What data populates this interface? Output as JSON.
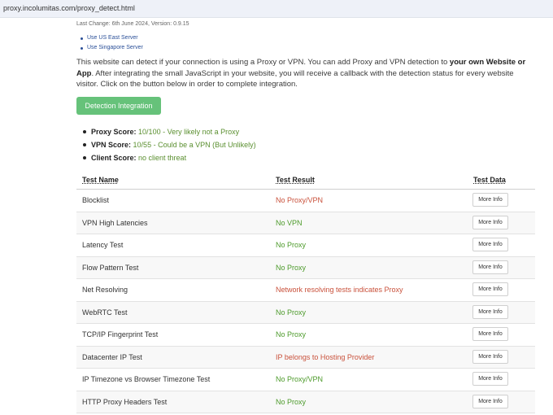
{
  "browser": {
    "url": "proxy.incolumitas.com/proxy_detect.html"
  },
  "meta": {
    "last_change": "Last Change: 6th June 2024, Version: 0.9.15"
  },
  "servers": [
    {
      "label": "Use US East Server"
    },
    {
      "label": "Use Singapore Server"
    }
  ],
  "intro": {
    "part1": "This website can detect if your connection is using a Proxy or VPN. You can add Proxy and VPN detection to ",
    "bold": "your own Website or App",
    "part2": ". After integrating the small JavaScript in your website, you will receive a callback with the detection status for every website visitor. Click on the button below in order to complete integration."
  },
  "integration_button": "Detection Integration",
  "scores": [
    {
      "label": "Proxy Score:",
      "value": "10/100 - Very likely not a Proxy"
    },
    {
      "label": "VPN Score:",
      "value": "10/55 - Could be a VPN (But Unlikely)"
    },
    {
      "label": "Client Score:",
      "value": "no client threat"
    }
  ],
  "table": {
    "headers": {
      "name": "Test Name",
      "result": "Test Result",
      "data": "Test Data"
    },
    "rows": [
      {
        "name": "Blocklist",
        "result": "No Proxy/VPN",
        "status": "bad",
        "button": "More Info"
      },
      {
        "name": "VPN High Latencies",
        "result": "No VPN",
        "status": "good",
        "button": "More Info"
      },
      {
        "name": "Latency Test",
        "result": "No Proxy",
        "status": "good",
        "button": "More Info"
      },
      {
        "name": "Flow Pattern Test",
        "result": "No Proxy",
        "status": "good",
        "button": "More Info"
      },
      {
        "name": "Net Resolving",
        "result": "Network resolving tests indicates Proxy",
        "status": "bad",
        "button": "More Info"
      },
      {
        "name": "WebRTC Test",
        "result": "No Proxy",
        "status": "good",
        "button": "More Info"
      },
      {
        "name": "TCP/IP Fingerprint Test",
        "result": "No Proxy",
        "status": "good",
        "button": "More Info"
      },
      {
        "name": "Datacenter IP Test",
        "result": "IP belongs to Hosting Provider",
        "status": "bad",
        "button": "More Info"
      },
      {
        "name": "IP Timezone vs Browser Timezone Test",
        "result": "No Proxy/VPN",
        "status": "good",
        "button": "More Info"
      },
      {
        "name": "HTTP Proxy Headers Test",
        "result": "No Proxy",
        "status": "good",
        "button": "More Info"
      }
    ]
  },
  "colors": {
    "good": "#4c9a2a",
    "bad": "#c9513b",
    "button_green": "#66c27a",
    "link": "#2a4f98"
  }
}
